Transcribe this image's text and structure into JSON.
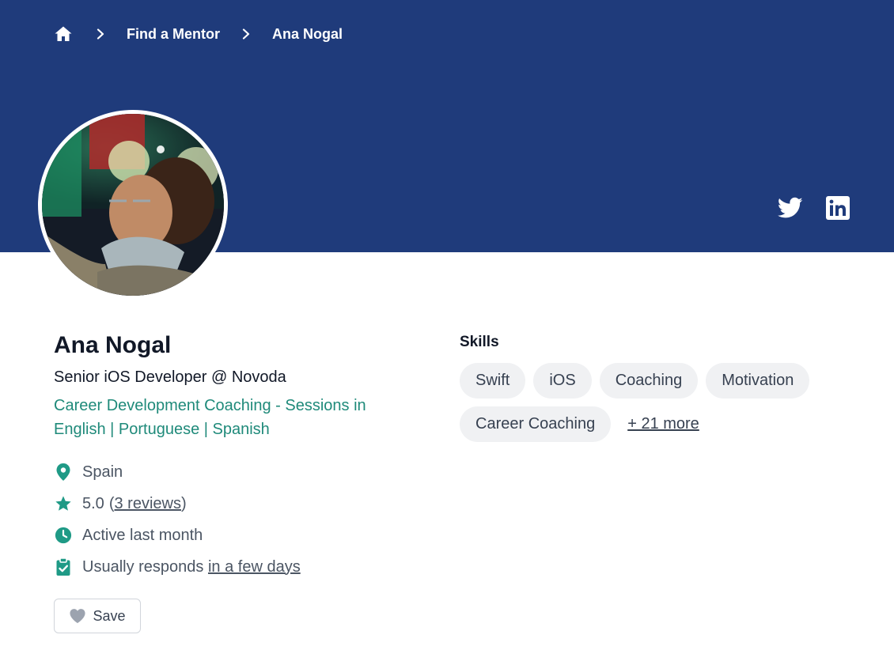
{
  "breadcrumb": {
    "home_icon": "home-icon",
    "items": [
      {
        "label": "Find a Mentor"
      },
      {
        "label": "Ana Nogal"
      }
    ]
  },
  "social": {
    "twitter_icon": "twitter-icon",
    "linkedin_icon": "linkedin-icon"
  },
  "colors": {
    "banner": "#1f3b7b",
    "accent": "#1f8a7a",
    "pill_bg": "#f0f1f3"
  },
  "profile": {
    "name": "Ana Nogal",
    "headline": "Senior iOS Developer @ Novoda",
    "tagline": "Career Development Coaching - Sessions in English | Portuguese | Spanish",
    "location": "Spain",
    "rating": "5.0",
    "reviews_prefix": "(",
    "reviews_link": "3 reviews",
    "reviews_suffix": ")",
    "activity": "Active last month",
    "responds_prefix": "Usually responds ",
    "responds_link": "in a few days",
    "save_label": "Save"
  },
  "skills": {
    "title": "Skills",
    "items": [
      "Swift",
      "iOS",
      "Coaching",
      "Motivation",
      "Career Coaching"
    ],
    "more_label": "+ 21 more"
  }
}
